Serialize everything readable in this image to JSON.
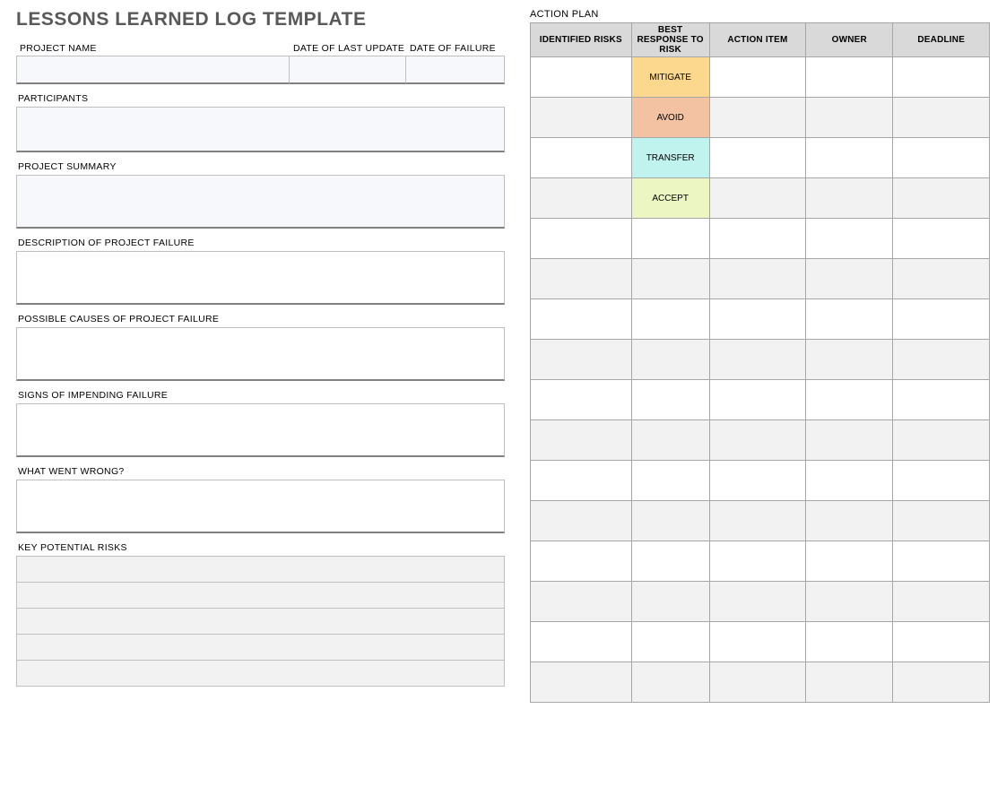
{
  "title": "LESSONS LEARNED LOG TEMPLATE",
  "labels": {
    "project_name": "PROJECT NAME",
    "date_last_update": "DATE OF LAST UPDATE",
    "date_failure": "DATE OF FAILURE",
    "participants": "PARTICIPANTS",
    "project_summary": "PROJECT SUMMARY",
    "description_failure": "DESCRIPTION OF PROJECT FAILURE",
    "possible_causes": "POSSIBLE CAUSES OF PROJECT FAILURE",
    "signs_impending": "SIGNS OF IMPENDING FAILURE",
    "what_went_wrong": "WHAT WENT WRONG?",
    "key_risks": "KEY POTENTIAL RISKS",
    "action_plan": "ACTION PLAN"
  },
  "key_risks_rows": [
    "",
    "",
    "",
    "",
    ""
  ],
  "action_plan": {
    "headers": {
      "risks": "IDENTIFIED RISKS",
      "response": "BEST RESPONSE TO RISK",
      "action_item": "ACTION ITEM",
      "owner": "OWNER",
      "deadline": "DEADLINE"
    },
    "response_options": {
      "mitigate": "MITIGATE",
      "avoid": "AVOID",
      "transfer": "TRANSFER",
      "accept": "ACCEPT"
    },
    "rows": [
      {
        "risk": "",
        "response": "mitigate",
        "action": "",
        "owner": "",
        "deadline": "",
        "shade": false
      },
      {
        "risk": "",
        "response": "avoid",
        "action": "",
        "owner": "",
        "deadline": "",
        "shade": true
      },
      {
        "risk": "",
        "response": "transfer",
        "action": "",
        "owner": "",
        "deadline": "",
        "shade": false
      },
      {
        "risk": "",
        "response": "accept",
        "action": "",
        "owner": "",
        "deadline": "",
        "shade": true
      },
      {
        "risk": "",
        "response": "",
        "action": "",
        "owner": "",
        "deadline": "",
        "shade": false
      },
      {
        "risk": "",
        "response": "",
        "action": "",
        "owner": "",
        "deadline": "",
        "shade": true
      },
      {
        "risk": "",
        "response": "",
        "action": "",
        "owner": "",
        "deadline": "",
        "shade": false
      },
      {
        "risk": "",
        "response": "",
        "action": "",
        "owner": "",
        "deadline": "",
        "shade": true
      },
      {
        "risk": "",
        "response": "",
        "action": "",
        "owner": "",
        "deadline": "",
        "shade": false
      },
      {
        "risk": "",
        "response": "",
        "action": "",
        "owner": "",
        "deadline": "",
        "shade": true
      },
      {
        "risk": "",
        "response": "",
        "action": "",
        "owner": "",
        "deadline": "",
        "shade": false
      },
      {
        "risk": "",
        "response": "",
        "action": "",
        "owner": "",
        "deadline": "",
        "shade": true
      },
      {
        "risk": "",
        "response": "",
        "action": "",
        "owner": "",
        "deadline": "",
        "shade": false
      },
      {
        "risk": "",
        "response": "",
        "action": "",
        "owner": "",
        "deadline": "",
        "shade": true
      },
      {
        "risk": "",
        "response": "",
        "action": "",
        "owner": "",
        "deadline": "",
        "shade": false
      },
      {
        "risk": "",
        "response": "",
        "action": "",
        "owner": "",
        "deadline": "",
        "shade": true
      }
    ]
  },
  "colors": {
    "mitigate": "#fcd88f",
    "avoid": "#f2c2a3",
    "transfer": "#c1f3ee",
    "accept": "#ecf6c3"
  }
}
